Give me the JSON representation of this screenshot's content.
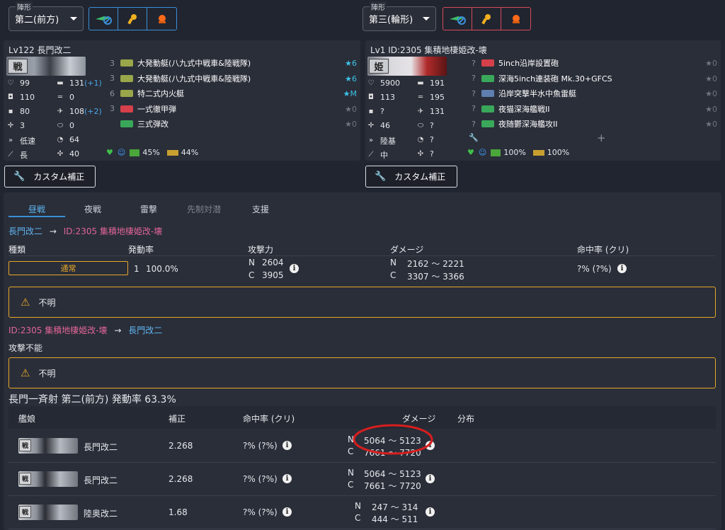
{
  "left_fleet": {
    "formation_label": "陣形",
    "formation_value": "第二(前方)"
  },
  "right_fleet": {
    "formation_label": "陣形",
    "formation_value": "第三(輪形)"
  },
  "left_ship": {
    "header": "Lv122 長門改二",
    "tag": "戦",
    "stats": [
      {
        "icon": "heart-icon",
        "value": "99"
      },
      {
        "icon": "firepower-icon",
        "value": "131",
        "bonus": "(+1)"
      },
      {
        "icon": "armor-icon",
        "value": "110"
      },
      {
        "icon": "torpedo-icon",
        "value": "0"
      },
      {
        "icon": "evasion-icon",
        "value": "80"
      },
      {
        "icon": "aa-icon",
        "value": "108",
        "bonus": "(+2)"
      },
      {
        "icon": "aircraft-icon",
        "value": "3"
      },
      {
        "icon": "asw-icon",
        "value": "0"
      },
      {
        "icon": "speed-icon",
        "value": "低速"
      },
      {
        "icon": "los-icon",
        "value": "64"
      },
      {
        "icon": "range-icon",
        "value": "長"
      },
      {
        "icon": "luck-icon",
        "value": "40"
      }
    ],
    "slots": [
      {
        "n": "3",
        "name": "大発動艇(八九式中戦車&陸戦隊)",
        "star": "★6",
        "color": "#9aa64a"
      },
      {
        "n": "3",
        "name": "大発動艇(八九式中戦車&陸戦隊)",
        "star": "★6",
        "color": "#9aa64a"
      },
      {
        "n": "6",
        "name": "特二式内火艇",
        "star": "★M",
        "color": "#9aa64a"
      },
      {
        "n": "3",
        "name": "一式徹甲弾",
        "star": "★0",
        "color": "#d6404a"
      },
      {
        "n": "",
        "name": "三式弾改",
        "star": "★0",
        "color": "#3aa85a"
      }
    ],
    "condition": {
      "fuel": "45%",
      "ammo": "44%"
    }
  },
  "right_ship": {
    "header": "Lv1 ID:2305 集積地棲姫改-壊",
    "tag": "姫",
    "stats": [
      {
        "icon": "heart-icon",
        "value": "5900"
      },
      {
        "icon": "firepower-icon",
        "value": "191"
      },
      {
        "icon": "armor-icon",
        "value": "113"
      },
      {
        "icon": "torpedo-icon",
        "value": "195"
      },
      {
        "icon": "evasion-icon",
        "value": "?"
      },
      {
        "icon": "aa-icon",
        "value": "131"
      },
      {
        "icon": "aircraft-icon",
        "value": "46"
      },
      {
        "icon": "asw-icon",
        "value": "?"
      },
      {
        "icon": "speed-icon",
        "value": "陸基"
      },
      {
        "icon": "los-icon",
        "value": "?"
      },
      {
        "icon": "range-icon",
        "value": "中"
      },
      {
        "icon": "luck-icon",
        "value": "?"
      }
    ],
    "slots": [
      {
        "n": "?",
        "name": "5inch沿岸設置砲",
        "star": "★0",
        "color": "#d6404a"
      },
      {
        "n": "?",
        "name": "深海5inch連装砲 Mk.30+GFCS",
        "star": "★0",
        "color": "#3aa85a"
      },
      {
        "n": "?",
        "name": "沿岸突撃半水中魚雷艇",
        "star": "★0",
        "color": "#5f7fb0"
      },
      {
        "n": "?",
        "name": "夜猫深海艦戦II",
        "star": "★0",
        "color": "#3aa85a"
      },
      {
        "n": "?",
        "name": "夜随鬱深海艦攻II",
        "star": "★0",
        "color": "#3aa85a"
      }
    ],
    "condition": {
      "fuel": "100%",
      "ammo": "100%"
    }
  },
  "custom_button": "カスタム補正",
  "tabs": [
    "昼戦",
    "夜戦",
    "雷撃",
    "先制対潜",
    "支援"
  ],
  "attack1": {
    "from": "長門改二",
    "to": "ID:2305 集積地棲姫改-壊",
    "headers": [
      "種類",
      "発動率",
      "攻撃力",
      "ダメージ",
      "命中率 (クリ)"
    ],
    "type": "通常",
    "count": "1",
    "rate": "100.0%",
    "power": [
      {
        "k": "N",
        "v": "2604"
      },
      {
        "k": "C",
        "v": "3905"
      }
    ],
    "damage": [
      {
        "k": "N",
        "v": "2162 ～ 2221"
      },
      {
        "k": "C",
        "v": "3307 ～ 3366"
      }
    ],
    "hit": "?% (?%)",
    "warning": "不明"
  },
  "attack2": {
    "from": "ID:2305 集積地棲姫改-壊",
    "to": "長門改二",
    "status": "攻撃不能",
    "warning": "不明"
  },
  "special": {
    "title": "長門一斉射 第二(前方) 発動率 63.3%",
    "headers": [
      "艦娘",
      "補正",
      "命中率 (クリ)",
      "ダメージ",
      "分布"
    ],
    "rows": [
      {
        "ship": "長門改二",
        "mod": "2.268",
        "hit": "?% (?%)",
        "n": "5064 ～ 5123",
        "c": "7661 ～ 7720"
      },
      {
        "ship": "長門改二",
        "mod": "2.268",
        "hit": "?% (?%)",
        "n": "5064 ～ 5123",
        "c": "7661 ～ 7720"
      },
      {
        "ship": "陸奥改二",
        "mod": "1.68",
        "hit": "?% (?%)",
        "n": "247 ～ 314",
        "c": "444 ～ 511"
      }
    ]
  }
}
